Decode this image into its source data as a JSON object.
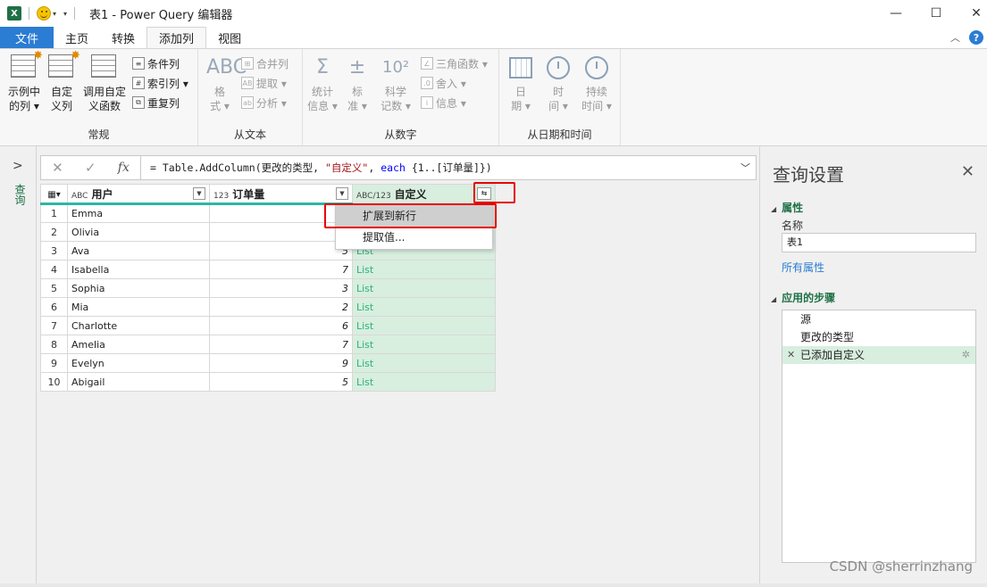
{
  "titlebar": {
    "app_icon": "X",
    "title": "表1 - Power Query 编辑器",
    "minimize": "—",
    "maximize": "☐",
    "close": "✕"
  },
  "ribbon_tabs": [
    {
      "label": "文件"
    },
    {
      "label": "主页"
    },
    {
      "label": "转换"
    },
    {
      "label": "添加列"
    },
    {
      "label": "视图"
    }
  ],
  "ribbon": {
    "groups": {
      "general": "常规",
      "from_text": "从文本",
      "from_number": "从数字",
      "from_datetime": "从日期和时间"
    },
    "general": {
      "col_from_examples": [
        "示例中",
        "的列 ▾"
      ],
      "custom_column": [
        "自定",
        "义列"
      ],
      "invoke_custom_function": [
        "调用自定",
        "义函数"
      ],
      "conditional_column": "条件列",
      "index_column": "索引列 ▾",
      "duplicate_column": "重复列"
    },
    "from_text": {
      "format": [
        "格",
        "式 ▾"
      ],
      "merge_columns": "合并列",
      "extract": "提取 ▾",
      "parse": "分析 ▾"
    },
    "from_number": {
      "statistics": [
        "统计",
        "信息 ▾"
      ],
      "standard": [
        "标",
        "准 ▾"
      ],
      "scientific": [
        "科学",
        "记数 ▾"
      ],
      "trigonometry": "三角函数 ▾",
      "rounding": "舍入 ▾",
      "information": "信息 ▾"
    },
    "from_datetime": {
      "date": [
        "日",
        "期 ▾"
      ],
      "time": [
        "时",
        "间 ▾"
      ],
      "duration": [
        "持续",
        "时间 ▾"
      ]
    }
  },
  "left_pane": {
    "label": "查询"
  },
  "formula_bar": {
    "prefix": "= Table.AddColumn(更改的类型, ",
    "string_literal": "\"自定义\"",
    "separator": ", ",
    "keyword": "each",
    "suffix": " {1..[订单量]})"
  },
  "table": {
    "columns": [
      {
        "type": "ABC",
        "name": "用户"
      },
      {
        "type": "123",
        "name": "订单量"
      },
      {
        "type": "ABC/123",
        "name": "自定义"
      }
    ],
    "rows": [
      {
        "n": "1",
        "user": "Emma",
        "orders": "",
        "custom": ""
      },
      {
        "n": "2",
        "user": "Olivia",
        "orders": "",
        "custom": ""
      },
      {
        "n": "3",
        "user": "Ava",
        "orders": "5",
        "custom": "List"
      },
      {
        "n": "4",
        "user": "Isabella",
        "orders": "7",
        "custom": "List"
      },
      {
        "n": "5",
        "user": "Sophia",
        "orders": "3",
        "custom": "List"
      },
      {
        "n": "6",
        "user": "Mia",
        "orders": "2",
        "custom": "List"
      },
      {
        "n": "7",
        "user": "Charlotte",
        "orders": "6",
        "custom": "List"
      },
      {
        "n": "8",
        "user": "Amelia",
        "orders": "7",
        "custom": "List"
      },
      {
        "n": "9",
        "user": "Evelyn",
        "orders": "9",
        "custom": "List"
      },
      {
        "n": "10",
        "user": "Abigail",
        "orders": "5",
        "custom": "List"
      }
    ]
  },
  "expand_menu": {
    "items": [
      "扩展到新行",
      "提取值..."
    ]
  },
  "query_settings": {
    "title": "查询设置",
    "properties_header": "属性",
    "name_label": "名称",
    "name_value": "表1",
    "all_properties": "所有属性",
    "applied_steps_header": "应用的步骤",
    "steps": [
      "源",
      "更改的类型",
      "已添加自定义"
    ]
  },
  "watermark": "CSDN @sherrinzhang",
  "colors": {
    "file_tab": "#2b7cd3",
    "custom_col_bg": "#d8eedf",
    "list_text": "#2cb27a",
    "highlight": "#e60000",
    "section_header": "#1e7145"
  }
}
